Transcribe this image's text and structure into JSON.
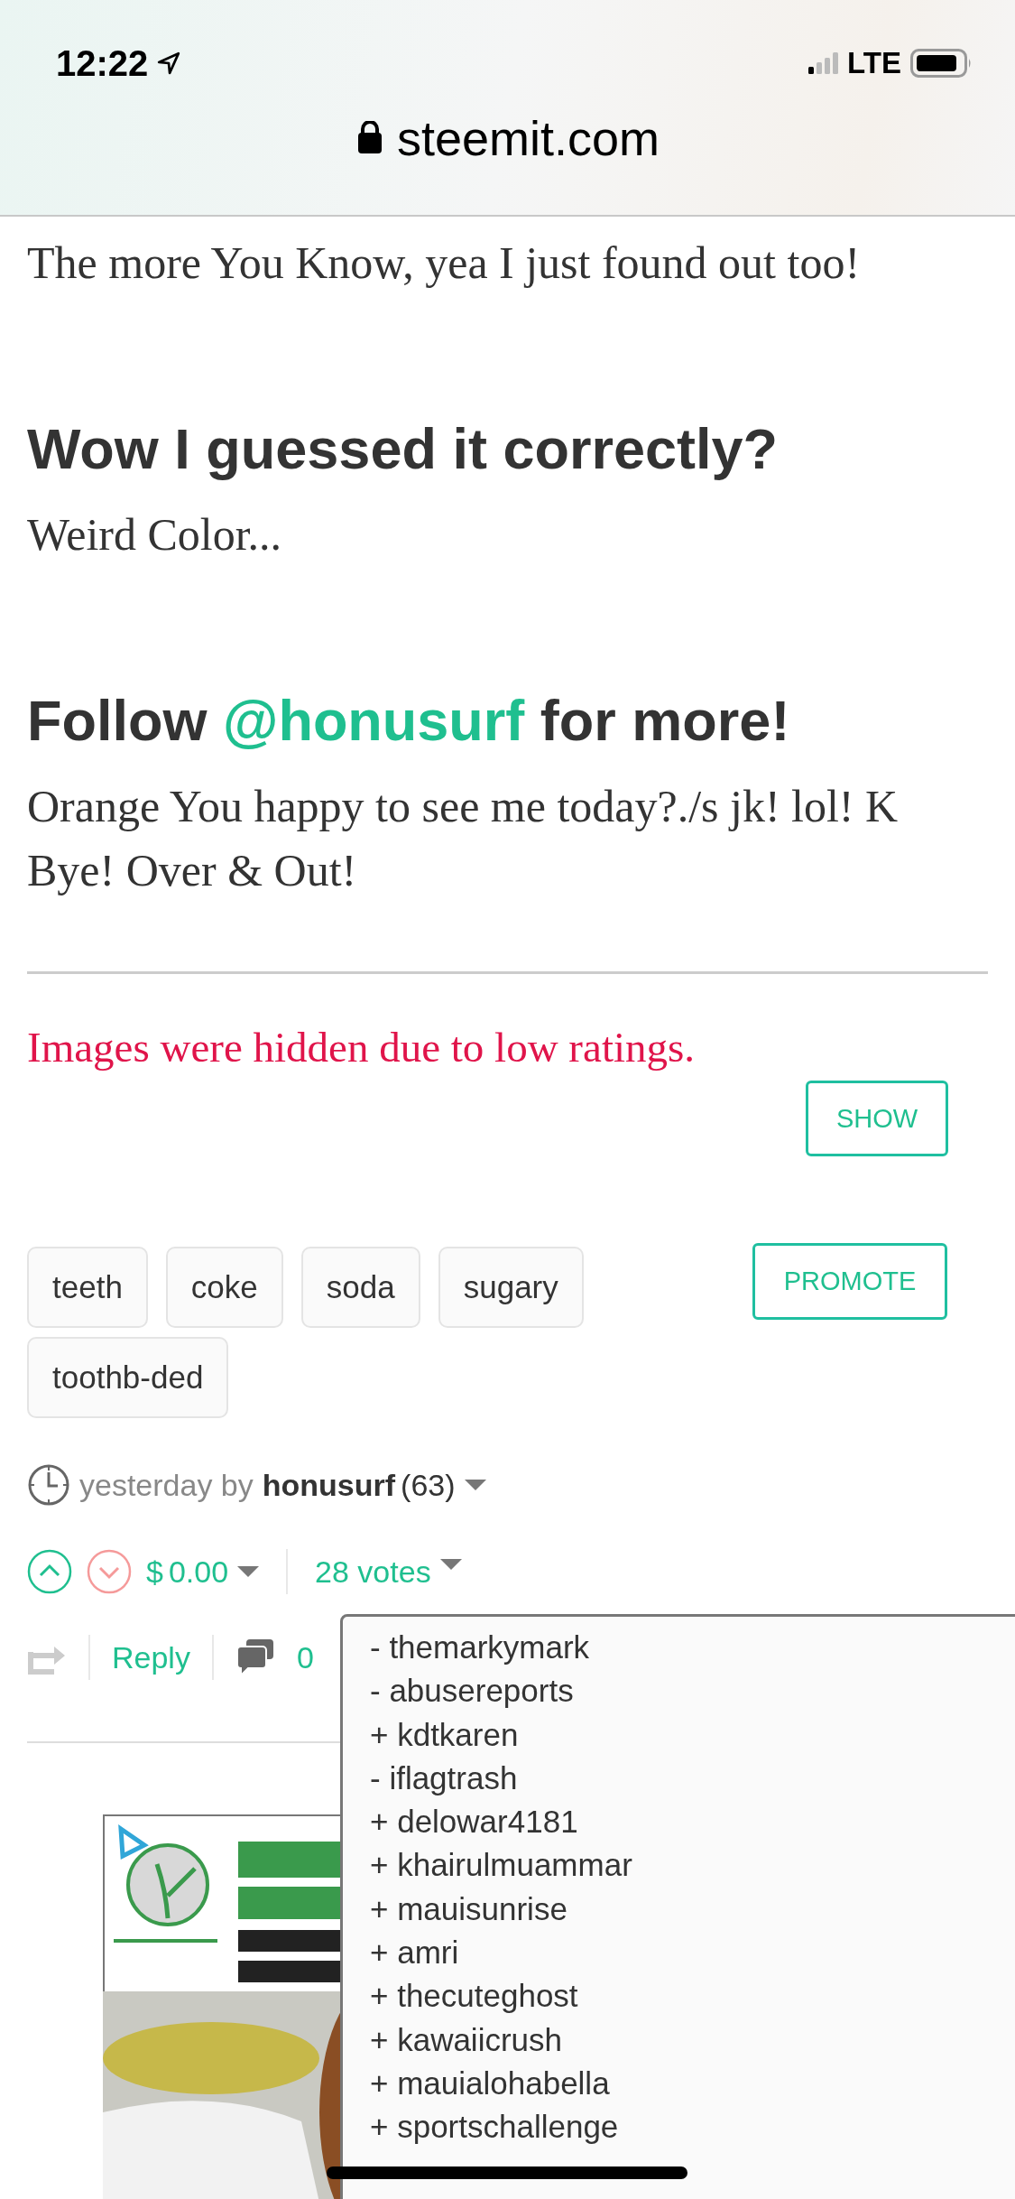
{
  "status_bar": {
    "time": "12:22",
    "network": "LTE"
  },
  "address_bar": {
    "url": "steemit.com"
  },
  "post": {
    "blocks": [
      {
        "kind": "paragraph",
        "text": "The more You Know, yea I just found out too!"
      },
      {
        "kind": "heading",
        "text": "Wow I guessed it correctly?"
      },
      {
        "kind": "paragraph",
        "text": "Weird Color..."
      },
      {
        "kind": "heading",
        "text": "Follow ",
        "link": "@honusurf",
        "text_after": " for more!"
      },
      {
        "kind": "paragraph",
        "text": "Orange You happy to see me today?./s jk! lol! K Bye! Over & Out!"
      }
    ],
    "hidden_notice": {
      "text": "Images were hidden due to low ratings.",
      "button": "SHOW"
    }
  },
  "tags": [
    "teeth",
    "coke",
    "soda",
    "sugary",
    "toothb-ded"
  ],
  "promote_button": "PROMOTE",
  "meta": {
    "time": "yesterday by",
    "author": "honusurf",
    "reputation": "(63)"
  },
  "votes": {
    "currency": "$",
    "amount": "0.00",
    "count": "28 votes"
  },
  "actions": {
    "reply": "Reply",
    "comments": "0"
  },
  "voters": [
    "- themarkymark",
    "- abusereports",
    "+ kdtkaren",
    "- iflagtrash",
    "+ delowar4181",
    "+ khairulmuammar",
    "+ mauisunrise",
    "+ amri",
    "+ thecuteghost",
    "+ kawaiicrush",
    "+ mauialohabella",
    "+ sportschallenge"
  ]
}
